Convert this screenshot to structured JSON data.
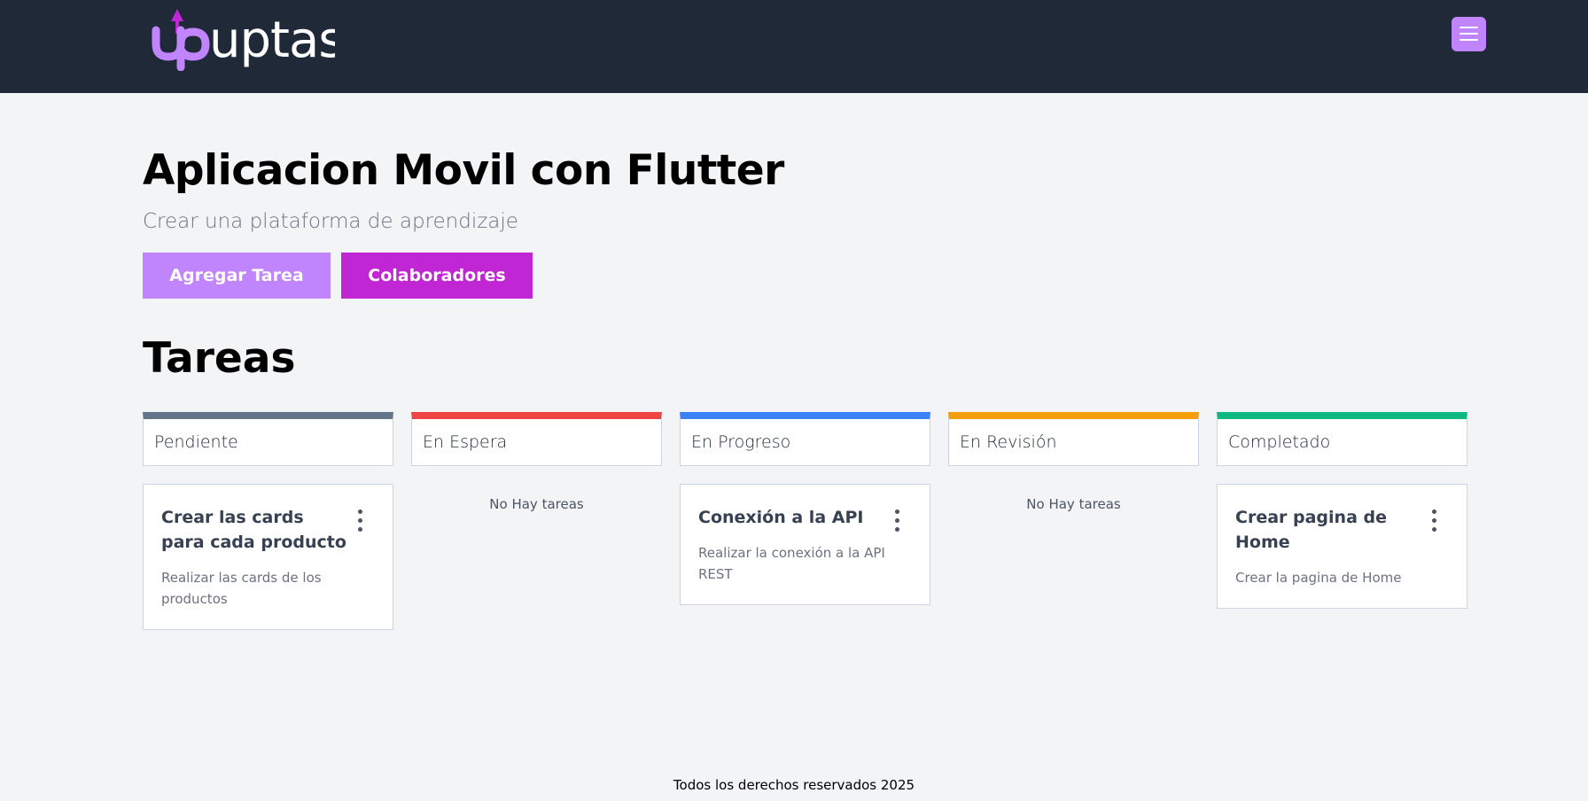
{
  "app": {
    "logo_text": "uptask"
  },
  "header": {
    "menu_icon": "hamburger-icon"
  },
  "project": {
    "title": "Aplicacion Movil con Flutter",
    "description": "Crear una plataforma de aprendizaje"
  },
  "actions": {
    "add_task_label": "Agregar Tarea",
    "collaborators_label": "Colaboradores"
  },
  "tasks_section": {
    "title": "Tareas"
  },
  "columns": [
    {
      "label": "Pendiente",
      "color": "#64748b",
      "task": {
        "title": "Crear las cards para cada producto",
        "description": "Realizar las cards de los productos"
      }
    },
    {
      "label": "En Espera",
      "color": "#ef4444",
      "empty_text": "No Hay tareas"
    },
    {
      "label": "En Progreso",
      "color": "#3b82f6",
      "task": {
        "title": "Conexión a la API",
        "description": "Realizar la conexión a la API REST"
      }
    },
    {
      "label": "En Revisión",
      "color": "#f59e0b",
      "empty_text": "No Hay tareas"
    },
    {
      "label": "Completado",
      "color": "#10b981",
      "task": {
        "title": "Crear pagina de Home",
        "description": "Crear la pagina de Home"
      }
    }
  ],
  "footer": {
    "text": "Todos los derechos reservados 2025"
  },
  "colors": {
    "header_bg": "#1f2937",
    "accent_light": "#c084fc",
    "accent_dark": "#c026d3"
  }
}
